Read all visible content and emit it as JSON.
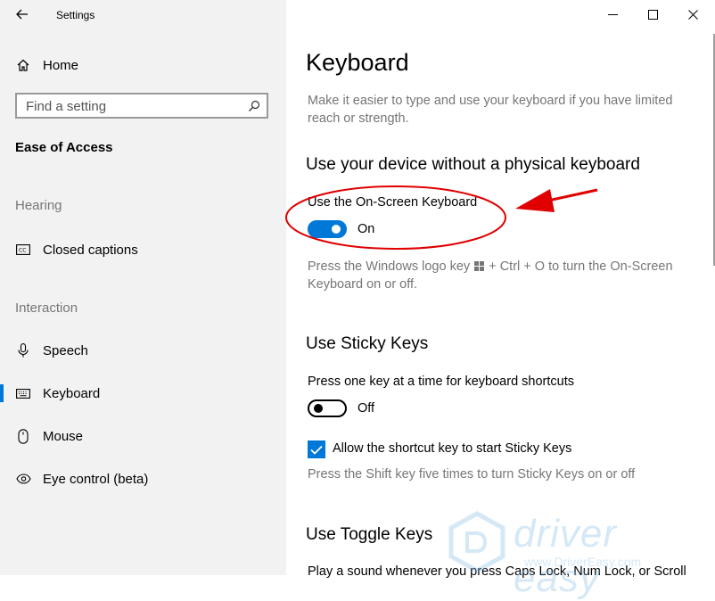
{
  "window": {
    "title": "Settings",
    "back_icon": "back-arrow-icon",
    "controls": [
      "minimize-icon",
      "maximize-icon",
      "close-icon"
    ]
  },
  "sidebar": {
    "home_label": "Home",
    "search_placeholder": "Find a setting",
    "category": "Ease of Access",
    "sections": [
      {
        "heading": "Hearing",
        "items": [
          {
            "label": "Closed captions",
            "icon": "closed-captions-icon"
          }
        ]
      },
      {
        "heading": "Interaction",
        "items": [
          {
            "label": "Speech",
            "icon": "microphone-icon"
          },
          {
            "label": "Keyboard",
            "icon": "keyboard-icon",
            "selected": true
          },
          {
            "label": "Mouse",
            "icon": "mouse-icon"
          },
          {
            "label": "Eye control (beta)",
            "icon": "eye-control-icon"
          }
        ]
      }
    ],
    "accent_color": "#0078d7"
  },
  "main": {
    "title": "Keyboard",
    "intro": "Make it easier to type and use your keyboard if you have limited reach or strength.",
    "osk_section": {
      "heading": "Use your device without a physical keyboard",
      "setting_label": "Use the On-Screen Keyboard",
      "toggle_state": "On",
      "help_pre": "Press the Windows logo key",
      "help_post": "+ Ctrl + O to turn the On-Screen Keyboard on or off."
    },
    "sticky_section": {
      "heading": "Use Sticky Keys",
      "setting_label": "Press one key at a time for keyboard shortcuts",
      "toggle_state": "Off",
      "checkbox_label": "Allow the shortcut key to start Sticky Keys",
      "checkbox_checked": true,
      "help": "Press the Shift key five times to turn Sticky Keys on or off"
    },
    "toggle_section": {
      "heading": "Use Toggle Keys",
      "setting_label": "Play a sound whenever you press Caps Lock, Num Lock, or Scroll"
    }
  },
  "watermark": {
    "brand": "driver easy",
    "url": "www.DriverEasy.com"
  },
  "annotation_color": "#e00000"
}
